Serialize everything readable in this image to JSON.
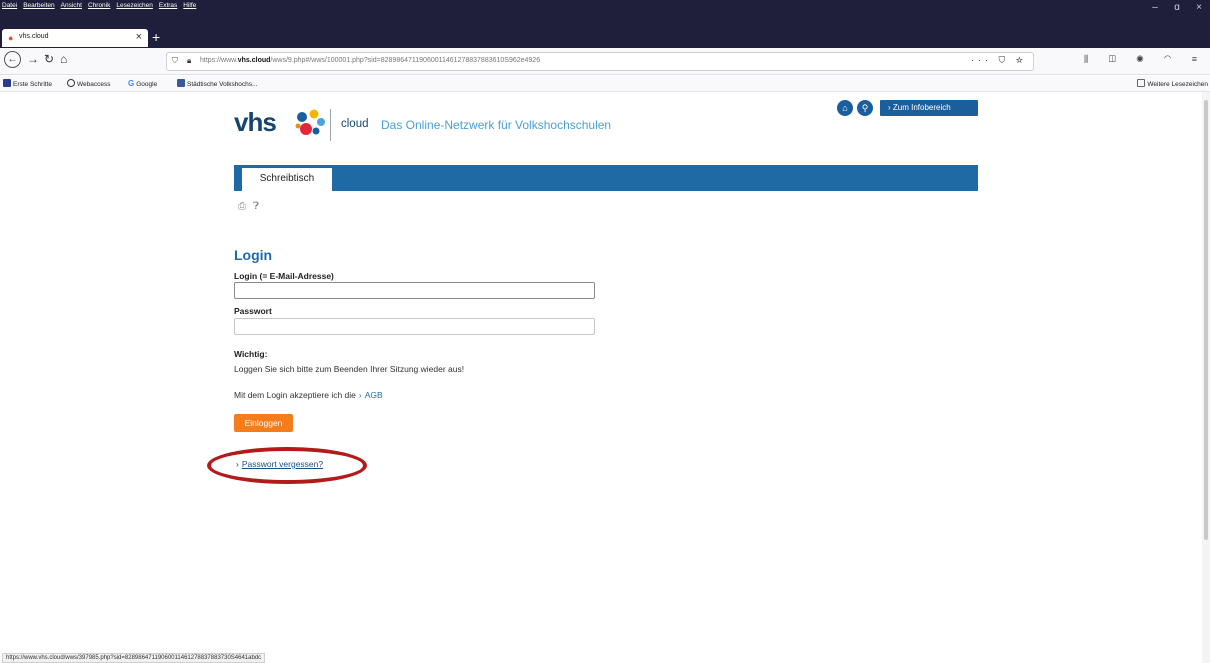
{
  "browser": {
    "menu": [
      "Datei",
      "Bearbeiten",
      "Ansicht",
      "Chronik",
      "Lesezeichen",
      "Extras",
      "Hilfe"
    ],
    "window_controls": {
      "minimize": "–",
      "maximize": "ɑ",
      "close": "×"
    },
    "tab": {
      "title": "vhs.cloud",
      "close": "×"
    },
    "new_tab": "+",
    "url": {
      "prefix": "https://www.",
      "domain": "vhs.cloud",
      "path": "/wws/9.php#/wws/100001.php?sid=82898647119060011461278837883610S962e4926"
    },
    "url_actions": "··· ⛉ ☆",
    "toolbar_icons": "⫼ ◫ ◉ ◠ ≡",
    "bookmarks": [
      "Erste Schritte",
      "Webaccess",
      "Google",
      "Städtische Volkshochs..."
    ],
    "bookmarks_more": "Weitere Lesezeichen",
    "status_url": "https://www.vhs.cloud/wws/397985.php?sid=82898647119060011461278837883730S4641abdc"
  },
  "header": {
    "logo_text": "vhs",
    "cloud_label": "cloud",
    "tagline": "Das Online-Netzwerk für Volkshochschulen",
    "info_button": "Zum Infobereich"
  },
  "nav": {
    "tab_label": "Schreibtisch"
  },
  "login": {
    "title": "Login",
    "email_label": "Login (= E-Mail-Adresse)",
    "email_value": "",
    "password_label": "Passwort",
    "password_value": "",
    "note_title": "Wichtig:",
    "note_text": "Loggen Sie sich bitte zum Beenden Ihrer Sitzung wieder aus!",
    "agb_text": "Mit dem Login akzeptiere ich die",
    "agb_link": "AGB",
    "submit_label": "Einloggen",
    "forgot_link": "Passwort vergessen?"
  },
  "colors": {
    "brand_blue": "#1f6aa5",
    "brand_navy": "#17436f",
    "button_orange": "#f47c1a",
    "highlight_red": "#b31b1b"
  }
}
